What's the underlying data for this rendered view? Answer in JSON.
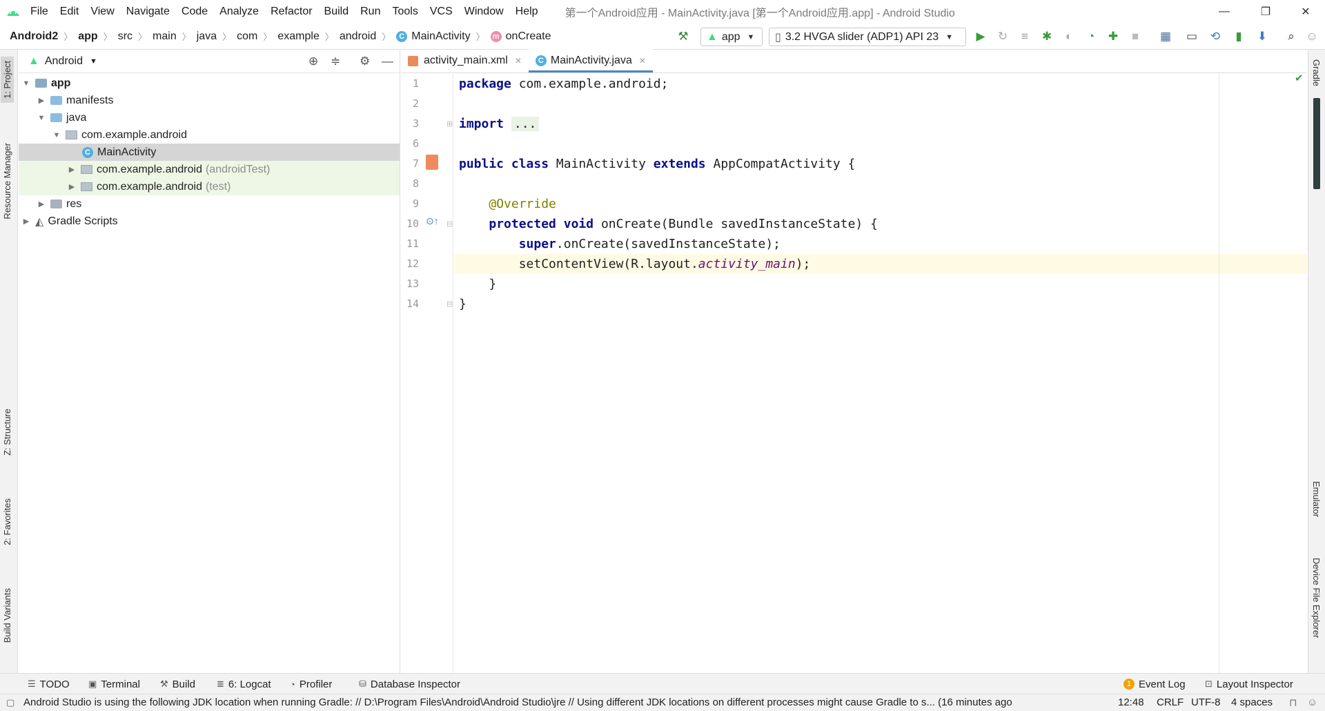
{
  "window": {
    "title": "第一个Android应用 - MainActivity.java [第一个Android应用.app] - Android Studio",
    "controls": [
      "—",
      "❐",
      "✕"
    ]
  },
  "menu": [
    "File",
    "Edit",
    "View",
    "Navigate",
    "Code",
    "Analyze",
    "Refactor",
    "Build",
    "Run",
    "Tools",
    "VCS",
    "Window",
    "Help"
  ],
  "breadcrumb": [
    "Android2",
    "app",
    "src",
    "main",
    "java",
    "com",
    "example",
    "android",
    "MainActivity",
    "onCreate"
  ],
  "run_config": {
    "label": "app"
  },
  "device": {
    "label": "3.2  HVGA slider (ADP1) API 23"
  },
  "left_tabs": [
    "1: Project",
    "Resource Manager",
    "Z: Structure",
    "2: Favorites",
    "Build Variants"
  ],
  "right_tabs": [
    "Gradle",
    "Emulator",
    "Device File Explorer"
  ],
  "project": {
    "view_mode": "Android",
    "tree": [
      {
        "label": "app",
        "suffix": ""
      },
      {
        "label": "manifests",
        "suffix": ""
      },
      {
        "label": "java",
        "suffix": ""
      },
      {
        "label": "com.example.android",
        "suffix": ""
      },
      {
        "label": "MainActivity",
        "suffix": ""
      },
      {
        "label": "com.example.android",
        "suffix": "(androidTest)"
      },
      {
        "label": "com.example.android",
        "suffix": "(test)"
      },
      {
        "label": "res",
        "suffix": ""
      },
      {
        "label": "Gradle Scripts",
        "suffix": ""
      }
    ]
  },
  "editor": {
    "tabs": [
      {
        "label": "activity_main.xml",
        "active": false
      },
      {
        "label": "MainActivity.java",
        "active": true
      }
    ],
    "line_numbers": [
      "1",
      "2",
      "3",
      "6",
      "7",
      "8",
      "9",
      "10",
      "11",
      "12",
      "13",
      "14"
    ],
    "code": {
      "l1_kw": "package",
      "l1_rest": " com.example.android;",
      "l3_kw": "import",
      "l3_fold": "...",
      "l7_kw1": "public",
      "l7_kw2": "class",
      "l7_name": " MainActivity ",
      "l7_kw3": "extends",
      "l7_rest": " AppCompatActivity {",
      "l9_ann": "@Override",
      "l10_kw1": "protected",
      "l10_kw2": "void",
      "l10_rest": " onCreate(Bundle savedInstanceState) {",
      "l11_kw": "super",
      "l11_rest": ".onCreate(savedInstanceState);",
      "l12_a": "setContentView(R.layout.",
      "l12_ital": "activity_main",
      "l12_b": ");",
      "l13": "}",
      "l14": "}"
    }
  },
  "bottom_tools": [
    {
      "label": "TODO"
    },
    {
      "label": "Terminal"
    },
    {
      "label": "Build"
    },
    {
      "label": "6: Logcat"
    },
    {
      "label": "Profiler"
    },
    {
      "label": "Database Inspector"
    }
  ],
  "bottom_right_tools": [
    {
      "label": "Event Log",
      "badge": "1"
    },
    {
      "label": "Layout Inspector"
    }
  ],
  "status": {
    "message": "Android Studio is using the following JDK location when running Gradle: // D:\\Program Files\\Android\\Android Studio\\jre // Using different JDK locations on different processes might cause Gradle to s... (16 minutes ago",
    "position": "12:48",
    "line_sep": "CRLF",
    "encoding": "UTF-8",
    "indent": "4 spaces"
  },
  "colors": {
    "accent": "#4a86c7",
    "android_green": "#3ddc84",
    "current_line": "#fffae3"
  }
}
